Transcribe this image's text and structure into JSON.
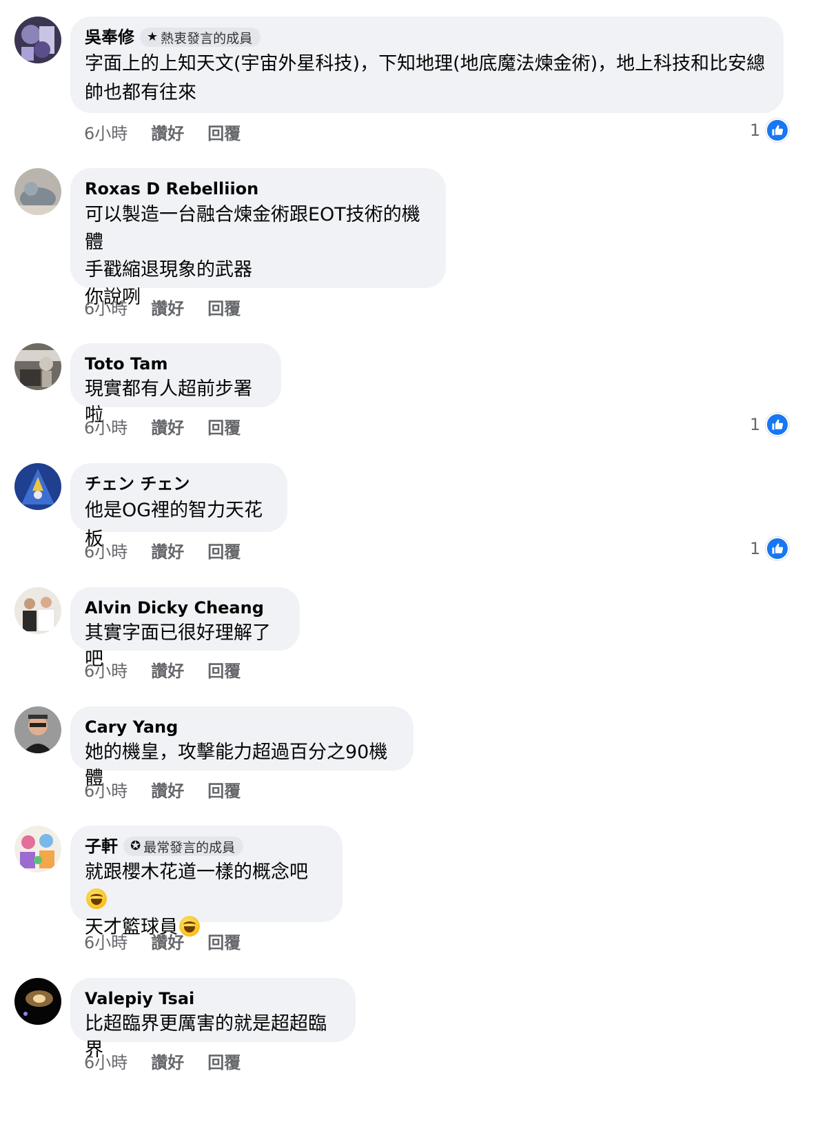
{
  "comments": [
    {
      "author": "吳奉修",
      "badge": "熱衷發言的成員",
      "badge_icon": "star-icon",
      "text": "字面上的上知天文(宇宙外星科技)，下知地理(地底魔法煉金術)，地上科技和比安總\n帥也都有往來",
      "time": "6小時",
      "like_label": "讚好",
      "reply_label": "回覆",
      "reactions": "1"
    },
    {
      "author": "Roxas D Rebelliion",
      "text": "可以製造一台融合煉金術跟EOT技術的機體\n手戳縮退現象的武器\n你說咧",
      "time": "6小時",
      "like_label": "讚好",
      "reply_label": "回覆"
    },
    {
      "author": "Toto Tam",
      "text": "現實都有人超前步署啦",
      "time": "6小時",
      "like_label": "讚好",
      "reply_label": "回覆",
      "reactions": "1"
    },
    {
      "author": "チェン チェン",
      "text": "他是OG裡的智力天花板",
      "time": "6小時",
      "like_label": "讚好",
      "reply_label": "回覆",
      "reactions": "1"
    },
    {
      "author": "Alvin Dicky Cheang",
      "text": "其實字面已很好理解了吧",
      "time": "6小時",
      "like_label": "讚好",
      "reply_label": "回覆"
    },
    {
      "author": "Cary Yang",
      "text": "她的機皇，攻擊能力超過百分之90機體",
      "time": "6小時",
      "like_label": "讚好",
      "reply_label": "回覆"
    },
    {
      "author": "子軒",
      "badge": "最常發言的成員",
      "badge_icon": "ribbon-icon",
      "text_line1": "就跟櫻木花道一樣的概念吧",
      "text_line2": "天才籃球員",
      "emoji": "grinning-squinting-face-icon",
      "time": "6小時",
      "like_label": "讚好",
      "reply_label": "回覆"
    },
    {
      "author": "Valepiy Tsai",
      "text": "比超臨界更厲害的就是超超臨界",
      "time": "6小時",
      "like_label": "讚好",
      "reply_label": "回覆"
    }
  ],
  "colors": {
    "bubble": "#f0f2f5",
    "like_blue": "#1877f2",
    "meta_text": "#65676b"
  }
}
